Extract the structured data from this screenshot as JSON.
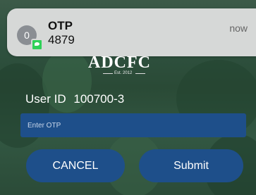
{
  "notification": {
    "avatar_initial": "0",
    "title": "OTP",
    "body": "4879",
    "time": "now"
  },
  "logo": {
    "text": "ADCFC",
    "subtext": "Est. 2012"
  },
  "form": {
    "user_id_label": "User ID",
    "user_id_value": "100700-3",
    "otp_placeholder": "Enter OTP",
    "otp_value": ""
  },
  "buttons": {
    "cancel": "CANCEL",
    "submit": "Submit"
  },
  "colors": {
    "accent": "#1e4f8a",
    "notification_bg": "#d6d8d7",
    "badge_green": "#2fd158"
  }
}
